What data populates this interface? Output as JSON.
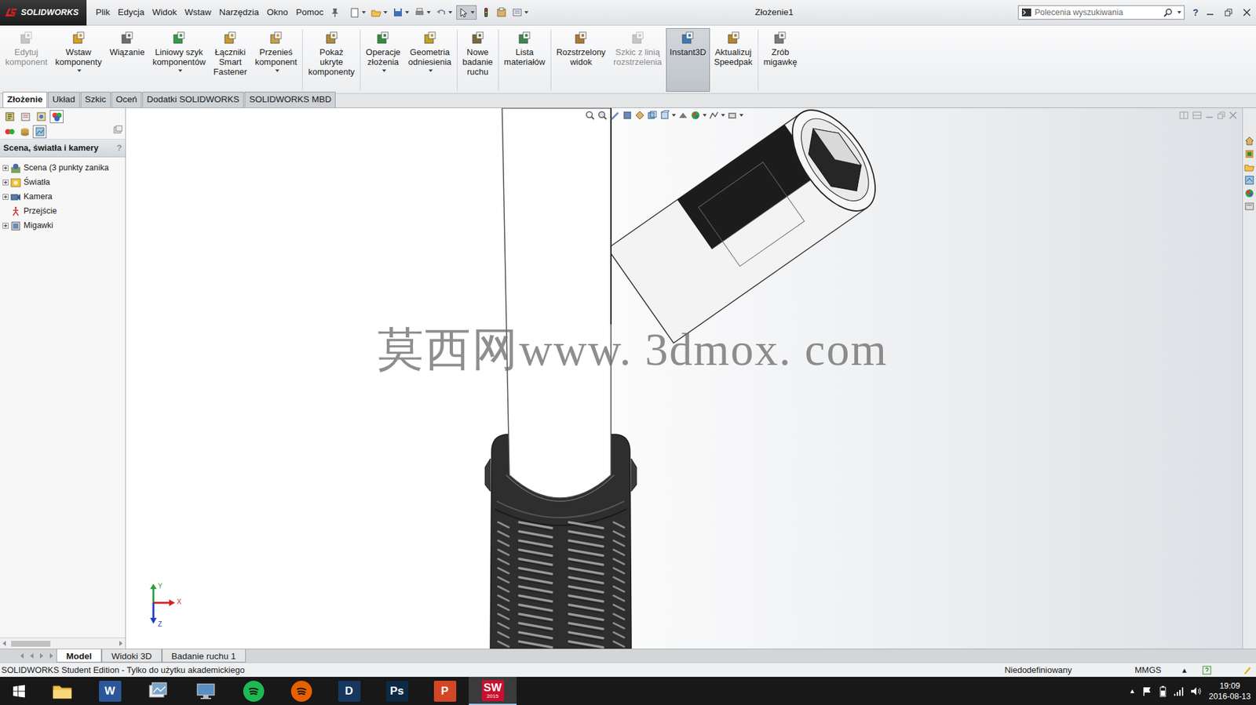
{
  "window": {
    "title": "Złożenie1"
  },
  "brand": {
    "text": "SOLIDWORKS"
  },
  "menu": [
    "Plik",
    "Edycja",
    "Widok",
    "Wstaw",
    "Narzędzia",
    "Okno",
    "Pomoc"
  ],
  "search": {
    "placeholder": "Polecenia wyszukiwania"
  },
  "help": "?",
  "ribbon": {
    "buttons": [
      {
        "lines": [
          "Edytuj",
          "komponent"
        ],
        "disabled": true,
        "selected": false,
        "dropdown": false,
        "separator_after": false
      },
      {
        "lines": [
          "Wstaw",
          "komponenty"
        ],
        "disabled": false,
        "selected": false,
        "dropdown": true,
        "separator_after": false
      },
      {
        "lines": [
          "Wiązanie"
        ],
        "disabled": false,
        "selected": false,
        "dropdown": false,
        "separator_after": false
      },
      {
        "lines": [
          "Liniowy szyk",
          "komponentów"
        ],
        "disabled": false,
        "selected": false,
        "dropdown": true,
        "separator_after": false
      },
      {
        "lines": [
          "Łączniki",
          "Smart",
          "Fastener"
        ],
        "disabled": false,
        "selected": false,
        "dropdown": false,
        "separator_after": false
      },
      {
        "lines": [
          "Przenieś",
          "komponent"
        ],
        "disabled": false,
        "selected": false,
        "dropdown": true,
        "separator_after": true
      },
      {
        "lines": [
          "Pokaż",
          "ukryte",
          "komponenty"
        ],
        "disabled": false,
        "selected": false,
        "dropdown": false,
        "separator_after": true
      },
      {
        "lines": [
          "Operacje",
          "złożenia"
        ],
        "disabled": false,
        "selected": false,
        "dropdown": true,
        "separator_after": false
      },
      {
        "lines": [
          "Geometria",
          "odniesienia"
        ],
        "disabled": false,
        "selected": false,
        "dropdown": true,
        "separator_after": true
      },
      {
        "lines": [
          "Nowe",
          "badanie",
          "ruchu"
        ],
        "disabled": false,
        "selected": false,
        "dropdown": false,
        "separator_after": true
      },
      {
        "lines": [
          "Lista",
          "materiałów"
        ],
        "disabled": false,
        "selected": false,
        "dropdown": false,
        "separator_after": true
      },
      {
        "lines": [
          "Rozstrzelony",
          "widok"
        ],
        "disabled": false,
        "selected": false,
        "dropdown": false,
        "separator_after": false
      },
      {
        "lines": [
          "Szkic z linią",
          "rozstrzelenia"
        ],
        "disabled": true,
        "selected": false,
        "dropdown": false,
        "separator_after": false
      },
      {
        "lines": [
          "Instant3D"
        ],
        "disabled": false,
        "selected": true,
        "dropdown": false,
        "separator_after": false
      },
      {
        "lines": [
          "Aktualizuj",
          "Speedpak"
        ],
        "disabled": false,
        "selected": false,
        "dropdown": false,
        "separator_after": true
      },
      {
        "lines": [
          "Zrób",
          "migawkę"
        ],
        "disabled": false,
        "selected": false,
        "dropdown": false,
        "separator_after": false
      }
    ]
  },
  "tabs": [
    {
      "label": "Złożenie",
      "selected": true
    },
    {
      "label": "Układ",
      "selected": false
    },
    {
      "label": "Szkic",
      "selected": false
    },
    {
      "label": "Oceń",
      "selected": false
    },
    {
      "label": "Dodatki SOLIDWORKS",
      "selected": false
    },
    {
      "label": "SOLIDWORKS MBD",
      "selected": false
    }
  ],
  "panel": {
    "tabs": [
      {
        "selected": false
      },
      {
        "selected": false
      },
      {
        "selected": false
      },
      {
        "selected": true
      }
    ],
    "filters": [
      {
        "selected": false
      },
      {
        "selected": false
      },
      {
        "selected": true
      }
    ],
    "title": "Scena, światła i kamery",
    "help": "?",
    "tree": [
      {
        "label": "Scena (3 punkty zanika",
        "expandable": true,
        "expanded": false
      },
      {
        "label": "Światła",
        "expandable": true,
        "expanded": false
      },
      {
        "label": "Kamera",
        "expandable": true,
        "expanded": false
      },
      {
        "label": "Przejście",
        "expandable": false,
        "expanded": false
      },
      {
        "label": "Migawki",
        "expandable": true,
        "expanded": false
      }
    ]
  },
  "viewport": {
    "watermark": "莫西网www. 3dmox. com",
    "triad": {
      "x": "X",
      "y": "Y",
      "z": "Z"
    }
  },
  "bottom_tabs": [
    {
      "label": "Model",
      "selected": true
    },
    {
      "label": "Widoki 3D",
      "selected": false
    },
    {
      "label": "Badanie ruchu 1",
      "selected": false
    }
  ],
  "status_bar": {
    "message": "SOLIDWORKS Student Edition - Tylko do użytku akademickiego",
    "state": "Niedodefiniowany",
    "units": "MMGS",
    "units_arrow": "▴"
  },
  "taskbar": {
    "apps": [
      {
        "kind": "folder",
        "color": "#f2c14e",
        "active": false
      },
      {
        "kind": "tile",
        "glyph": "W",
        "color": "#2b579a",
        "active": false
      },
      {
        "kind": "picture",
        "color": "#7aa3c9",
        "active": false
      },
      {
        "kind": "monitor",
        "color": "#5a8fc4",
        "active": false
      },
      {
        "kind": "circle",
        "color": "#1db954",
        "active": false
      },
      {
        "kind": "circle",
        "color": "#e66000",
        "active": false
      },
      {
        "kind": "tile",
        "glyph": "D",
        "color": "#17375e",
        "active": false
      },
      {
        "kind": "tile",
        "glyph": "Ps",
        "color": "#0b2a44",
        "active": false
      },
      {
        "kind": "tile",
        "glyph": "P",
        "color": "#d24726",
        "active": false
      },
      {
        "kind": "tile",
        "glyph": "SW",
        "badge": "2015",
        "color": "#c8102e",
        "active": true
      }
    ],
    "tray_arrow": "▲",
    "clock": {
      "time": "19:09",
      "date": "2016-08-13"
    }
  }
}
